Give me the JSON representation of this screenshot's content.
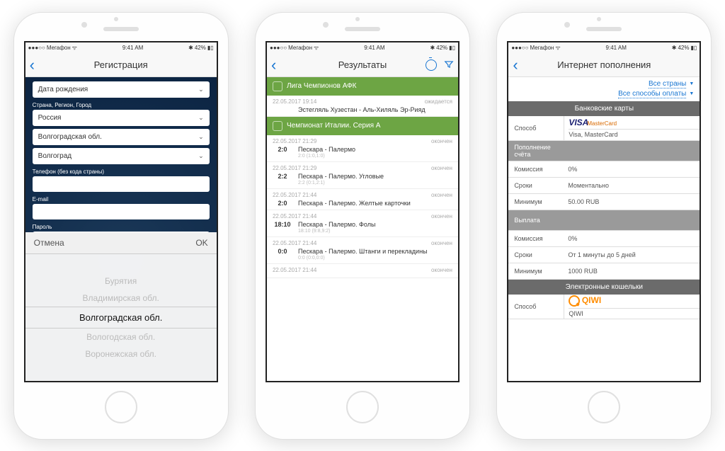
{
  "status": {
    "carrier": "Мегафон",
    "time": "9:41 AM",
    "battery": "42%"
  },
  "phone1": {
    "title": "Регистрация",
    "dob_label": "Дата рождения",
    "region_label": "Страна, Регион, Город",
    "country": "Россия",
    "region": "Волгоградская обл.",
    "city": "Волгоград",
    "phone_label": "Телефон (без кода страны)",
    "email_label": "E-mail",
    "password_label": "Пароль",
    "picker": {
      "cancel": "Отмена",
      "ok": "OK",
      "items": [
        "Бурятия",
        "Владимирская обл.",
        "Волгоградская обл.",
        "Вологодская обл.",
        "Воронежская обл."
      ]
    }
  },
  "phone2": {
    "title": "Результаты",
    "leagues": [
      {
        "name": "Лига Чемпионов АФК",
        "rows": [
          {
            "t": "22.05.2017 19:14",
            "st": "ожидается",
            "s": "",
            "m": "Эстегляль Хузестан - Аль-Хиляль Эр-Рияд"
          }
        ]
      },
      {
        "name": "Чемпионат Италии. Серия А",
        "rows": [
          {
            "t": "22.05.2017 21:29",
            "st": "окончен",
            "s": "2:0",
            "m": "Пескара - Палермо",
            "sub": "2:0 (1:0,1:0)"
          },
          {
            "t": "22.05.2017 21:29",
            "st": "окончен",
            "s": "2:2",
            "m": "Пескара - Палермо. Угловые",
            "sub": "2:2 (0:1,2:1)"
          },
          {
            "t": "22.05.2017 21:44",
            "st": "окончен",
            "s": "2:0",
            "m": "Пескара - Палермо. Желтые карточки",
            "sub": ""
          },
          {
            "t": "22.05.2017 21:44",
            "st": "окончен",
            "s": "18:10",
            "m": "Пескара - Палермо. Фолы",
            "sub": "18:10 (9:8,9:2)"
          },
          {
            "t": "22.05.2017 21:44",
            "st": "окончен",
            "s": "0:0",
            "m": "Пескара - Палермо. Штанги и перекладины",
            "sub": "0:0 (0:0,0:0)"
          },
          {
            "t": "22.05.2017 21:44",
            "st": "окончен",
            "s": "",
            "m": "",
            "sub": ""
          }
        ]
      }
    ]
  },
  "phone3": {
    "title": "Интернет пополнения",
    "filter1": "Все страны",
    "filter2": "Все способы оплаты",
    "section1": "Банковские карты",
    "method_l": "Способ",
    "method_v": "Visa, MasterCard",
    "topup_h": "Пополнение счёта",
    "fee_l": "Комиссия",
    "fee_v": "0%",
    "time_l": "Сроки",
    "time_v": "Моментально",
    "min_l": "Минимум",
    "min_v": "50.00 RUB",
    "payout_h": "Выплата",
    "pfee_v": "0%",
    "ptime_v": "От 1 минуты до 5 дней",
    "pmin_v": "1000 RUB",
    "section2": "Электронные кошельки",
    "qiwi": "QIWI"
  }
}
